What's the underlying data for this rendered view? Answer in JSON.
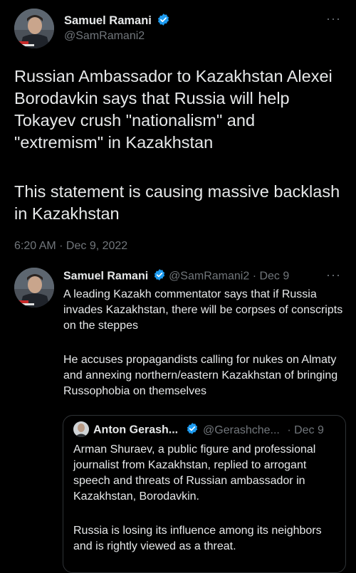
{
  "tweet": {
    "author_name": "Samuel Ramani",
    "author_handle": "@SamRamani2",
    "more_label": "···",
    "text_p1": "Russian Ambassador to Kazakhstan Alexei Borodavkin says that Russia will help Tokayev crush \"nationalism\" and \"extremism\" in Kazakhstan",
    "text_p2": "This statement is causing massive backlash in Kazakhstan",
    "timestamp": "6:20 AM · Dec 9, 2022"
  },
  "reply": {
    "author_name": "Samuel Ramani",
    "author_handle": "@SamRamani2",
    "date": "· Dec 9",
    "more_label": "···",
    "text_p1": "A leading Kazakh commentator says that if Russia invades Kazakhstan, there will be corpses of conscripts on the steppes",
    "text_p2": "He accuses propagandists calling for nukes on Almaty and annexing northern/eastern Kazakhstan of bringing Russophobia on themselves"
  },
  "quote": {
    "author_name": "Anton Gerash...",
    "author_handle": "@Gerashche...",
    "date": "· Dec 9",
    "text_p1": "Arman Shuraev, a public figure and professional journalist from Kazakhstan, replied to arrogant speech and threats of Russian ambassador in Kazakhstan, Borodavkin.",
    "text_p2": "Russia is losing its influence among its neighbors and is rightly viewed as a threat."
  },
  "colors": {
    "background": "#000000",
    "text": "#e7e9ea",
    "secondary": "#71767b",
    "verified": "#1d9bf0",
    "border": "#2f3336"
  },
  "icons": {
    "verified": "verified-badge-icon",
    "more": "more-dots-icon"
  }
}
